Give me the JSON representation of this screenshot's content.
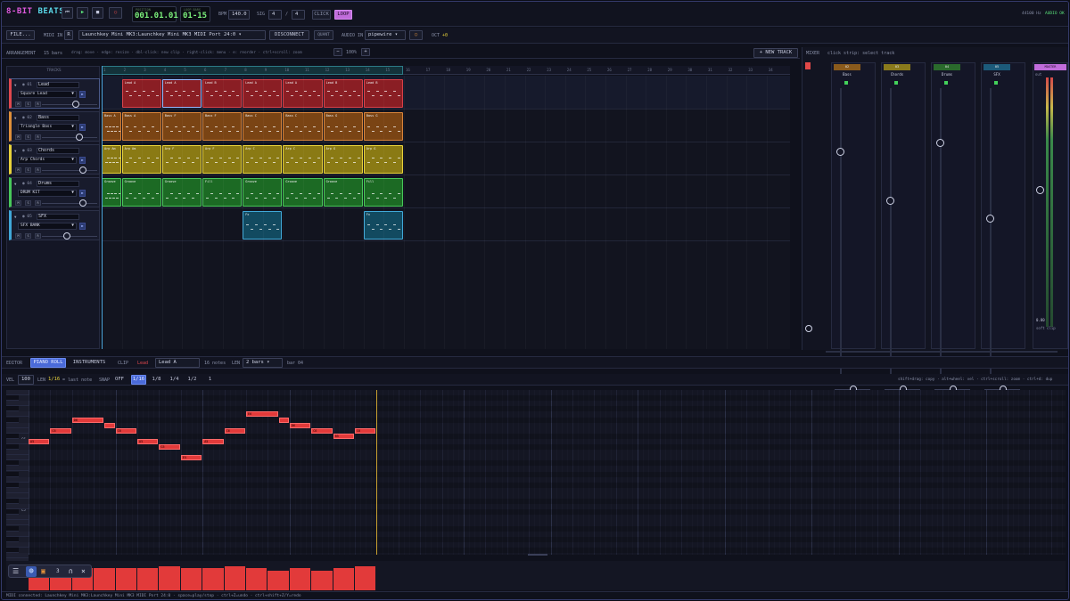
{
  "app": {
    "logo_a": "8-BIT",
    "logo_b": "BEATS"
  },
  "transport": {
    "position_cap": "POSITION",
    "position": "001.01.01",
    "loopbars_cap": "LOOP BARS",
    "loopbars": "01-15",
    "bpm_label": "BPM",
    "bpm": "140.0",
    "sig_label": "SIG",
    "sig_num": "4",
    "sig_sep": "/",
    "sig_den": "4",
    "click": "CLICK",
    "loop": "LOOP",
    "sample_rate": "44100 Hz",
    "audio_status": "AUDIO OK"
  },
  "midi": {
    "file": "FILE...",
    "midi_in": "MIDI IN",
    "r": "R",
    "port": "Launchkey Mini MK3:Launchkey Mini MK3 MIDI Port 24:0",
    "disconnect": "DISCONNECT",
    "quant": "QUANT",
    "audio_in": "AUDIO IN",
    "audio_device": "pipewire",
    "oct_label": "OCT",
    "oct": "+0"
  },
  "arrangement": {
    "label": "ARRANGEMENT",
    "bars": "15 bars",
    "hint": "drag: move · edge: resize · dbl-click: new clip · right-click: menu · e: reorder · ctrl+scroll: zoom",
    "zoom_out": "−",
    "zoom": "100%",
    "zoom_in": "+",
    "new_track": "+ NEW TRACK",
    "tracks_header": "TRACKS",
    "ruler": [
      "1",
      "2",
      "3",
      "4",
      "5",
      "6",
      "7",
      "8",
      "9",
      "10",
      "11",
      "12",
      "13",
      "14",
      "15",
      "16",
      "17",
      "18",
      "19",
      "20",
      "21",
      "22",
      "23",
      "24",
      "25",
      "26",
      "27",
      "28",
      "29",
      "30",
      "31",
      "32",
      "33",
      "34"
    ]
  },
  "tracks": [
    {
      "num": "01",
      "name": "Lead",
      "instrument": "Square Lead",
      "color": "#e0484e"
    },
    {
      "num": "02",
      "name": "Bass",
      "instrument": "Triangle Bass",
      "color": "#e0903a"
    },
    {
      "num": "03",
      "name": "Chords",
      "instrument": "Arp Chords",
      "color": "#e8d23a"
    },
    {
      "num": "04",
      "name": "Drums",
      "instrument": "DRUM KIT",
      "color": "#48c85a"
    },
    {
      "num": "05",
      "name": "SFX",
      "instrument": "SFX BANK",
      "color": "#40a8d8"
    }
  ],
  "track_btns": {
    "m": "M",
    "s": "S",
    "r": "R",
    "collapse": "▼",
    "eye": "◉"
  },
  "clips": {
    "lead": [
      "Lead A",
      "Lead A",
      "Lead B",
      "Lead A",
      "Lead A",
      "Lead B",
      "Lead B"
    ],
    "bass": [
      "Bass A",
      "Bass A",
      "Bass F",
      "Bass F",
      "Bass C",
      "Bass C",
      "Bass G",
      "Bass G"
    ],
    "chords": [
      "Arp Am",
      "Arp Am",
      "Arp F",
      "Arp F",
      "Arp C",
      "Arp C",
      "Arp G",
      "Arp G"
    ],
    "drums": [
      "Groove",
      "Groove",
      "Groove",
      "Fill",
      "Groove",
      "Groove",
      "Groove",
      "Fill"
    ],
    "sfx": [
      "Fx",
      "Fx"
    ]
  },
  "mixer": {
    "label": "MIXER",
    "hint": "click strip: select track",
    "strips": [
      {
        "num": "02",
        "name": "Bass",
        "db": "0.85",
        "pan": "C",
        "color": "#8a5a1c"
      },
      {
        "num": "03",
        "name": "Chords",
        "db": "0.80",
        "pan": "L20",
        "color": "#8a7a1c"
      },
      {
        "num": "04",
        "name": "Drums",
        "db": "0.90",
        "pan": "C",
        "color": "#2a6a2c"
      },
      {
        "num": "05",
        "name": "SFX",
        "db": "0.50",
        "pan": "C",
        "color": "#1c5a7a"
      }
    ],
    "master": "MASTER",
    "out": "out",
    "master_db": "0.80",
    "soft_clip": "soft clip"
  },
  "editor": {
    "label": "EDITOR",
    "piano_roll": "PIANO ROLL",
    "instruments": "INSTRUMENTS",
    "clip_label": "CLIP",
    "clip_track": "Lead",
    "clip_name": "Lead A",
    "notes": "16 notes",
    "len_label": "LEN",
    "len": "2 bars",
    "bar": "bar 04"
  },
  "pianoroll": {
    "vel_label": "VEL",
    "vel": "100",
    "len_label": "LEN",
    "len": "1/16",
    "last_note": "= last note",
    "snap_label": "SNAP",
    "snap_off": "OFF",
    "snaps": [
      "1/16",
      "1/8",
      "1/4",
      "1/2",
      "1"
    ],
    "hint": "shift+drag: copy · alt+wheel: vel · ctrl+scroll: zoom · ctrl+d: dup",
    "c6": "C6",
    "c5": "C5",
    "notes": [
      {
        "label": "A5",
        "c": 0,
        "r": 5,
        "w": 4
      },
      {
        "label": "C6",
        "c": 4,
        "r": 3,
        "w": 4
      },
      {
        "label": "D6",
        "c": 8,
        "r": 1,
        "w": 6
      },
      {
        "label": "",
        "c": 14,
        "r": 2,
        "w": 2
      },
      {
        "label": "C6",
        "c": 16,
        "r": 3,
        "w": 4
      },
      {
        "label": "A5",
        "c": 20,
        "r": 5,
        "w": 4
      },
      {
        "label": "G5",
        "c": 24,
        "r": 6,
        "w": 4
      },
      {
        "label": "E5",
        "c": 28,
        "r": 8,
        "w": 4
      },
      {
        "label": "A5",
        "c": 32,
        "r": 5,
        "w": 4
      },
      {
        "label": "C6",
        "c": 36,
        "r": 3,
        "w": 4
      },
      {
        "label": "E6",
        "c": 40,
        "r": 0,
        "w": 6
      },
      {
        "label": "",
        "c": 46,
        "r": 1,
        "w": 2
      },
      {
        "label": "D6",
        "c": 48,
        "r": 2,
        "w": 4
      },
      {
        "label": "C6",
        "c": 52,
        "r": 3,
        "w": 4
      },
      {
        "label": "B5",
        "c": 56,
        "r": 4,
        "w": 4
      },
      {
        "label": "C6",
        "c": 60,
        "r": 3,
        "w": 4
      }
    ]
  },
  "velocity": [
    82,
    82,
    82,
    82,
    82,
    82,
    90,
    82,
    82,
    90,
    82,
    75,
    82,
    75,
    82,
    90
  ],
  "dock": {
    "menu": "☰",
    "globe": "◍",
    "folder": "▣",
    "num": "3",
    "headphones": "∩",
    "close": "×"
  },
  "status": "MIDI connected: Launchkey Mini MK3:Launchkey Mini MK3 MIDI Port 24:0  ·  space=play/stop · ctrl+Z=undo · ctrl+shift+Z/Y=redo"
}
